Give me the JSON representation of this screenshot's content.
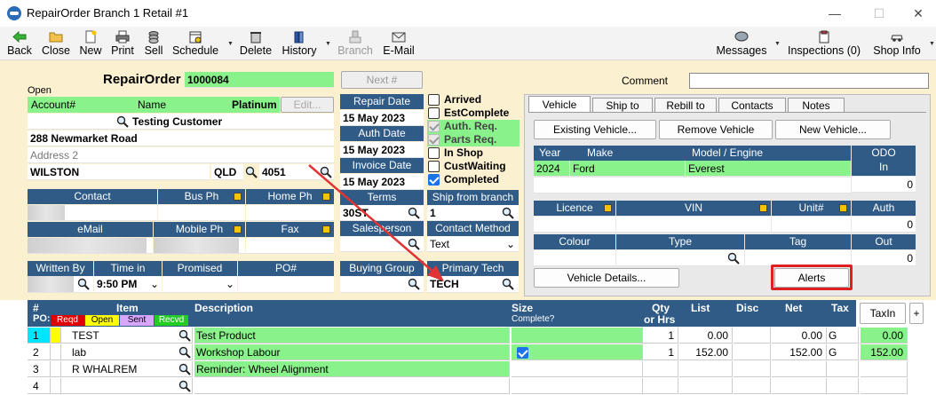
{
  "window": {
    "title": "RepairOrder  Branch 1  Retail #1"
  },
  "toolbar": {
    "back": "Back",
    "close": "Close",
    "new": "New",
    "print": "Print",
    "sell": "Sell",
    "schedule": "Schedule",
    "delete": "Delete",
    "history": "History",
    "branch": "Branch",
    "email": "E-Mail",
    "messages": "Messages",
    "inspections": "Inspections (0)",
    "shop_info": "Shop Info"
  },
  "header": {
    "title": "RepairOrder",
    "number": "1000084",
    "next_label": "Next #",
    "status": "Open",
    "comment_label": "Comment",
    "comment_value": ""
  },
  "customer": {
    "account_label": "Account#",
    "name_label": "Name",
    "tier": "Platinum",
    "edit_label": "Edit...",
    "name": "Testing Customer",
    "address1": "288 Newmarket Road",
    "address2_placeholder": "Address 2",
    "city": "WILSTON",
    "state": "QLD",
    "postcode": "4051"
  },
  "contact": {
    "contact_label": "Contact",
    "bus_ph_label": "Bus Ph",
    "home_ph_label": "Home Ph",
    "email_label": "eMail",
    "mobile_label": "Mobile Ph",
    "fax_label": "Fax"
  },
  "written": {
    "written_by_label": "Written By",
    "time_in_label": "Time in",
    "time_in": "9:50 PM",
    "promised_label": "Promised",
    "po_label": "PO#"
  },
  "dates": {
    "repair_label": "Repair Date",
    "repair": "15 May 2023",
    "auth_label": "Auth Date",
    "auth": "15 May 2023",
    "invoice_label": "Invoice Date",
    "invoice": "15 May 2023",
    "terms_label": "Terms",
    "terms": "30ST",
    "salesperson_label": "Salesperson",
    "buying_group_label": "Buying Group"
  },
  "flags": [
    {
      "label": "Arrived",
      "state": "off"
    },
    {
      "label": "EstComplete",
      "state": "off"
    },
    {
      "label": "Auth. Req.",
      "state": "dim"
    },
    {
      "label": "Parts Req.",
      "state": "dim"
    },
    {
      "label": "In Shop",
      "state": "off"
    },
    {
      "label": "CustWaiting",
      "state": "off"
    },
    {
      "label": "Completed",
      "state": "on"
    }
  ],
  "branch": {
    "ship_label": "Ship from branch",
    "ship_value": "1",
    "contact_method_label": "Contact Method",
    "contact_method": "Text",
    "primary_tech_label": "Primary Tech",
    "primary_tech": "TECH"
  },
  "vehicle": {
    "tabs": [
      "Vehicle",
      "Ship to",
      "Rebill to",
      "Contacts",
      "Notes"
    ],
    "existing_btn": "Existing Vehicle...",
    "remove_btn": "Remove Vehicle",
    "new_btn": "New Vehicle...",
    "year_label": "Year",
    "make_label": "Make",
    "model_label": "Model / Engine",
    "year": "2024",
    "make": "Ford",
    "model": "Everest",
    "odo_label": "ODO",
    "in_label": "In",
    "odo_in": "0",
    "licence_label": "Licence",
    "vin_label": "VIN",
    "unit_label": "Unit#",
    "auth_label": "Auth",
    "auth": "0",
    "colour_label": "Colour",
    "type_label": "Type",
    "tag_label": "Tag",
    "out_label": "Out",
    "out": "0",
    "details_btn": "Vehicle Details...",
    "alerts_btn": "Alerts"
  },
  "grid": {
    "col_num": "#",
    "col_po": "PO:",
    "col_item": "Item",
    "col_desc": "Description",
    "col_size": "Size",
    "col_complete": "Complete?",
    "col_qty": "Qty",
    "col_qty2": "or Hrs",
    "col_list": "List",
    "col_disc": "Disc",
    "col_net": "Net",
    "col_tax": "Tax",
    "taxin_btn": "TaxIn",
    "plus_btn": "+",
    "legend": [
      {
        "label": "Reqd",
        "color": "#e00000",
        "text": "#fff"
      },
      {
        "label": "Open",
        "color": "#ffff00",
        "text": "#000"
      },
      {
        "label": "Sent",
        "color": "#d9a6ff",
        "text": "#000"
      },
      {
        "label": "Recvd",
        "color": "#22cc22",
        "text": "#fff"
      }
    ],
    "rows": [
      {
        "num": "1",
        "item": "TEST",
        "desc": "Test Product",
        "complete": false,
        "qty": "1",
        "list": "0.00",
        "net": "0.00",
        "tax": "G",
        "taxin": "0.00"
      },
      {
        "num": "2",
        "item": "lab",
        "desc": "Workshop Labour",
        "complete": true,
        "qty": "1",
        "list": "152.00",
        "net": "152.00",
        "tax": "G",
        "taxin": "152.00"
      },
      {
        "num": "3",
        "item": "R WHALREM",
        "desc": "Reminder: Wheel Alignment",
        "complete": null,
        "qty": "",
        "list": "",
        "net": "",
        "tax": "",
        "taxin": ""
      },
      {
        "num": "4",
        "item": "",
        "desc": "",
        "complete": null,
        "qty": "",
        "list": "",
        "net": "",
        "tax": "",
        "taxin": ""
      }
    ]
  }
}
